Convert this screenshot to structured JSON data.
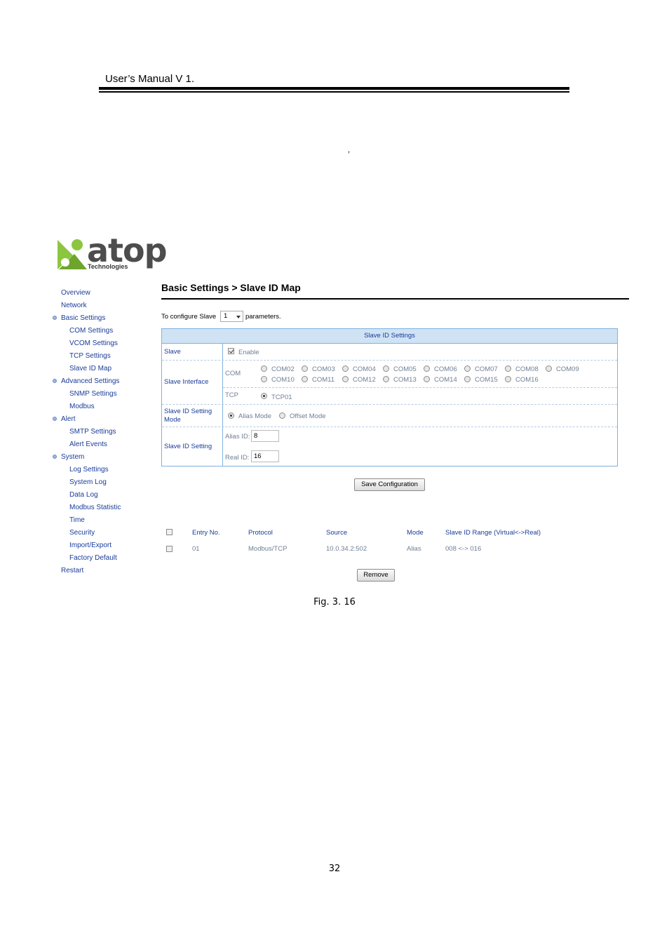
{
  "doc": {
    "header_title": "User’s Manual V 1.",
    "comma": ",",
    "figure_caption": "Fig. 3. 16",
    "page_number": "32"
  },
  "logo": {
    "name": "atop",
    "sub": "Technologies"
  },
  "sidebar": {
    "items": [
      {
        "label": "Overview"
      },
      {
        "label": "Network"
      },
      {
        "label": "Basic Settings"
      },
      {
        "label": "COM Settings"
      },
      {
        "label": "VCOM Settings"
      },
      {
        "label": "TCP Settings"
      },
      {
        "label": "Slave ID Map"
      },
      {
        "label": "Advanced Settings"
      },
      {
        "label": "SNMP Settings"
      },
      {
        "label": "Modbus"
      },
      {
        "label": "Alert"
      },
      {
        "label": "SMTP Settings"
      },
      {
        "label": "Alert Events"
      },
      {
        "label": "System"
      },
      {
        "label": "Log Settings"
      },
      {
        "label": "System Log"
      },
      {
        "label": "Data Log"
      },
      {
        "label": "Modbus Statistic"
      },
      {
        "label": "Time"
      },
      {
        "label": "Security"
      },
      {
        "label": "Import/Export"
      },
      {
        "label": "Factory Default"
      },
      {
        "label": "Restart"
      }
    ]
  },
  "main": {
    "title": "Basic Settings > Slave ID Map",
    "configure_prefix": "To configure Slave",
    "configure_value": "1",
    "configure_suffix": "parameters.",
    "settings_title": "Slave ID Settings",
    "slave_label": "Slave",
    "enable_label": "Enable",
    "slave_interface_label": "Slave Interface",
    "com_label": "COM",
    "com_ports": [
      "COM02",
      "COM03",
      "COM04",
      "COM05",
      "COM06",
      "COM07",
      "COM08",
      "COM09",
      "COM10",
      "COM11",
      "COM12",
      "COM13",
      "COM14",
      "COM15",
      "COM16"
    ],
    "tcp_label": "TCP",
    "tcp_port": "TCP01",
    "mode_label_1": "Slave ID Setting",
    "mode_label_2": "Mode",
    "alias_mode": "Alias Mode",
    "offset_mode": "Offset Mode",
    "id_setting_label": "Slave ID Setting",
    "alias_id_label": "Alias ID:",
    "alias_id_value": "8",
    "real_id_label": "Real ID:",
    "real_id_value": "16",
    "save_button": "Save Configuration",
    "table": {
      "headers": [
        "Entry No.",
        "Protocol",
        "Source",
        "Mode",
        "Slave ID Range (Virtual<->Real)"
      ],
      "rows": [
        [
          "01",
          "Modbus/TCP",
          "10.0.34.2:502",
          "Alias",
          "008 <-> 016"
        ]
      ]
    },
    "remove_button": "Remove"
  },
  "colors": {
    "link": "#1a3c99",
    "table_border": "#7fb0e0",
    "header_bg": "#cfe3f5",
    "logo_green": "#8cc63f"
  }
}
